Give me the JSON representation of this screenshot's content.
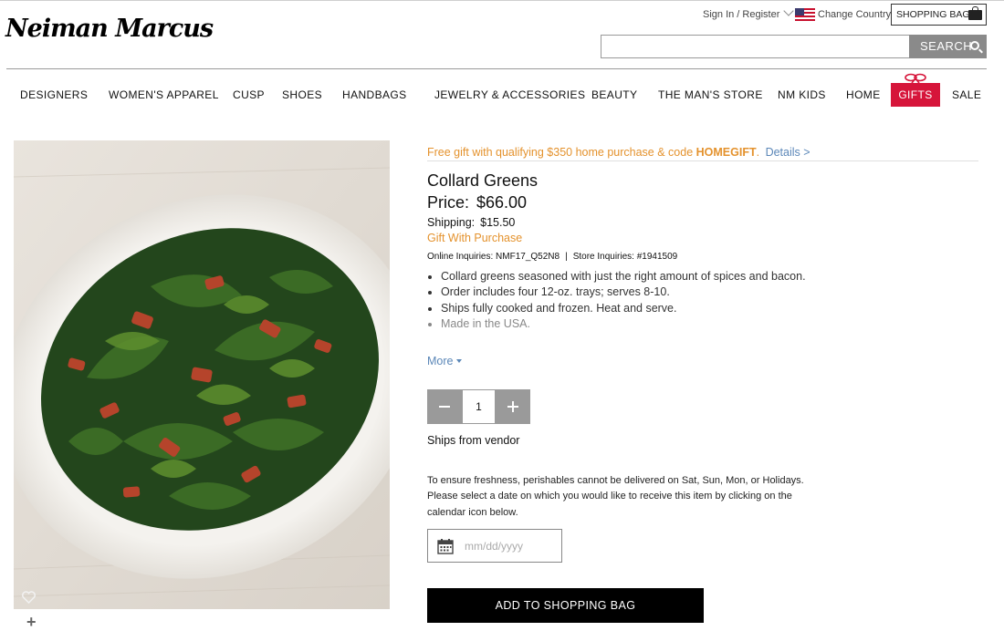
{
  "header": {
    "logo_text": "Neiman Marcus",
    "sign_in": "Sign In / Register",
    "change_country": "Change Country",
    "shopping_bag": "SHOPPING BAG",
    "search_placeholder": "",
    "search_button": "SEARCH"
  },
  "nav": {
    "items": [
      "DESIGNERS",
      "WOMEN'S APPAREL",
      "CUSP",
      "SHOES",
      "HANDBAGS",
      "JEWELRY & ACCESSORIES",
      "BEAUTY",
      "THE MAN'S STORE",
      "NM KIDS",
      "HOME",
      "GIFTS",
      "SALE"
    ],
    "active": "GIFTS",
    "active_color": "#d6153a"
  },
  "promo": {
    "text": "Free gift with qualifying $350 home purchase & code",
    "code": "HOMEGIFT",
    "period": ".",
    "details": "Details >"
  },
  "product": {
    "title": "Collard Greens",
    "price_label": "Price:",
    "price": "$66.00",
    "shipping_label": "Shipping:",
    "shipping": "$15.50",
    "gift_with_purchase": "Gift With Purchase",
    "online_inquiries": "Online Inquiries: NMF17_Q52N8",
    "inquiry_separator": "|",
    "store_inquiries": "Store Inquiries: #1941509",
    "features": [
      "Collard greens seasoned with just the right amount of spices and bacon.",
      "Order includes four 12-oz. trays; serves 8-10.",
      "Ships fully cooked and frozen. Heat and serve.",
      "Made in the USA."
    ],
    "more": "More",
    "quantity": "1",
    "ships_from": "Ships from vendor",
    "freshness_note": "To ensure freshness, perishables cannot be delivered on Sat, Sun, Mon, or Holidays. Please select a date on which you would like to receive this item by clicking on the calendar icon below.",
    "date_placeholder": "mm/dd/yyyy",
    "add_to_bag": "ADD TO SHOPPING BAG"
  },
  "icons": {
    "flag": "us-flag-icon",
    "bag": "shopping-bag-icon",
    "search": "search-icon",
    "gift_bow": "gift-bow-icon",
    "heart": "heart-icon",
    "zoom": "plus-icon",
    "calendar": "calendar-icon"
  },
  "colors": {
    "promo": "#e4922d",
    "link": "#5b87b8",
    "button_dark": "#000000",
    "qty_gray": "#9a9a9a"
  }
}
